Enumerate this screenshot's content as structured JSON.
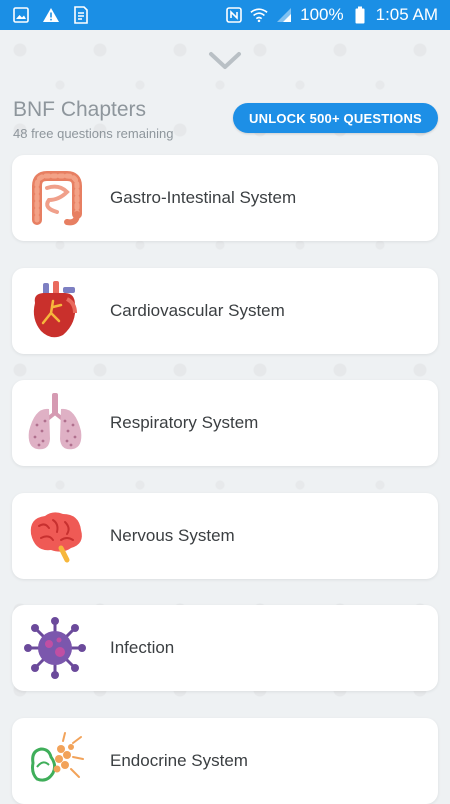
{
  "status_bar": {
    "battery": "100%",
    "time": "1:05 AM"
  },
  "header": {
    "title": "BNF Chapters",
    "subtitle": "48 free questions remaining",
    "unlock_label": "UNLOCK 500+ QUESTIONS"
  },
  "chapters": [
    {
      "label": "Gastro-Intestinal System",
      "icon": "intestine-icon"
    },
    {
      "label": "Cardiovascular System",
      "icon": "heart-icon"
    },
    {
      "label": "Respiratory System",
      "icon": "lungs-icon"
    },
    {
      "label": "Nervous System",
      "icon": "brain-icon"
    },
    {
      "label": "Infection",
      "icon": "virus-icon"
    },
    {
      "label": "Endocrine System",
      "icon": "pancreas-icon"
    }
  ],
  "colors": {
    "status_bar": "#1b8fe5",
    "accent": "#1d8fe6",
    "background": "#eef1f3"
  }
}
